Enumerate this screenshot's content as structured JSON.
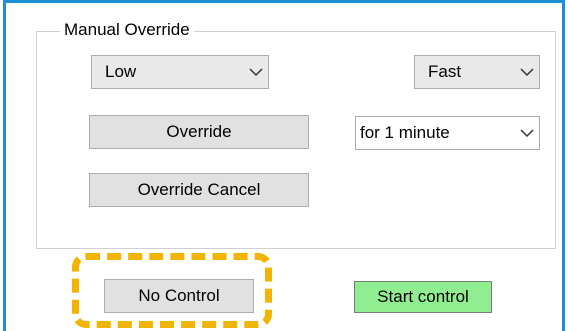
{
  "group": {
    "title": "Manual Override"
  },
  "level_combo": {
    "value": "Low",
    "icon": "chevron-down-icon"
  },
  "speed_combo": {
    "value": "Fast",
    "icon": "chevron-down-icon"
  },
  "duration_combo": {
    "value": "for 1 minute",
    "icon": "chevron-down-icon"
  },
  "buttons": {
    "override": "Override",
    "override_cancel": "Override Cancel",
    "no_control": "No Control",
    "start_control": "Start control"
  },
  "colors": {
    "window_border": "#1e90d8",
    "start_control_bg": "#90ee90",
    "highlight_dash": "#f1b400"
  }
}
